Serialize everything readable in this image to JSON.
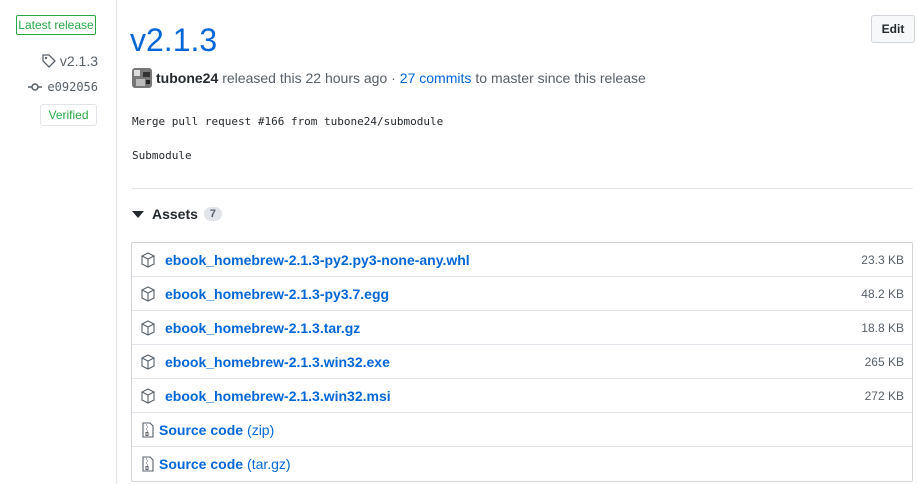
{
  "sidebar": {
    "latest_badge": "Latest release",
    "tag": "v2.1.3",
    "commit": "e092056",
    "verified": "Verified"
  },
  "release": {
    "title": "v2.1.3",
    "edit_label": "Edit",
    "author": "tubone24",
    "released_text": "released this 22 hours ago ·",
    "commits_link": "27 commits",
    "since_text": "to master since this release",
    "body_line1": "Merge pull request #166 from tubone24/submodule",
    "body_line2": "Submodule"
  },
  "assets": {
    "header": "Assets",
    "count": "7",
    "items": [
      {
        "name": "ebook_homebrew-2.1.3-py2.py3-none-any.whl",
        "size": "23.3 KB"
      },
      {
        "name": "ebook_homebrew-2.1.3-py3.7.egg",
        "size": "48.2 KB"
      },
      {
        "name": "ebook_homebrew-2.1.3.tar.gz",
        "size": "18.8 KB"
      },
      {
        "name": "ebook_homebrew-2.1.3.win32.exe",
        "size": "265 KB"
      },
      {
        "name": "ebook_homebrew-2.1.3.win32.msi",
        "size": "272 KB"
      }
    ],
    "sources": [
      {
        "label": "Source code",
        "ext": "(zip)"
      },
      {
        "label": "Source code",
        "ext": "(tar.gz)"
      }
    ]
  },
  "colors": {
    "link": "#0366d6",
    "success": "#28a745",
    "muted": "#586069"
  }
}
